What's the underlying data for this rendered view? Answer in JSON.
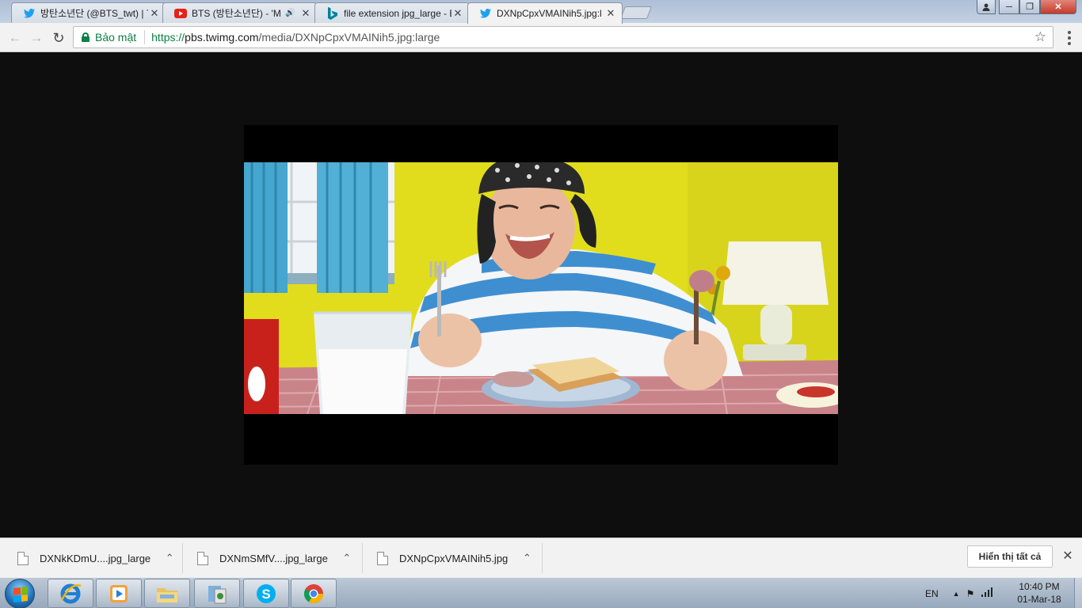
{
  "tabs": [
    {
      "title": "방탄소년단 (@BTS_twt) | T",
      "icon": "twitter-icon",
      "close": "✕"
    },
    {
      "title": "BTS (방탄소년단) - 'M",
      "icon": "youtube-icon",
      "audio": "🔊",
      "close": "✕"
    },
    {
      "title": "file extension jpg_large - B",
      "icon": "bing-icon",
      "close": "✕"
    },
    {
      "title": "DXNpCpxVMAINih5.jpg:l",
      "icon": "twitter-icon",
      "close": "✕",
      "active": true
    }
  ],
  "window_controls": {
    "minimize": "─",
    "maximize": "❐",
    "close": "✕",
    "user": "👤"
  },
  "toolbar": {
    "back": "←",
    "forward": "→",
    "reload": "↻",
    "security_label": "Bảo mật",
    "url_scheme": "https://",
    "url_host": "pbs.twimg.com",
    "url_path": "/media/DXNpCpxVMAINih5.jpg:large",
    "star": "☆"
  },
  "image": {
    "description_icon": "photo-of-person-eating-breakfast"
  },
  "downloads": [
    {
      "name": "DXNkKDmU....jpg_large",
      "chevron": "⌃"
    },
    {
      "name": "DXNmSMfV....jpg_large",
      "chevron": "⌃"
    },
    {
      "name": "DXNpCpxVMAINih5.jpg",
      "chevron": "⌃"
    }
  ],
  "download_bar": {
    "show_all": "Hiển thị tất cả",
    "close": "✕"
  },
  "taskbar": {
    "apps": [
      "internet-explorer-icon",
      "media-player-icon",
      "file-explorer-icon",
      "installer-icon",
      "skype-icon",
      "chrome-icon"
    ],
    "language": "EN",
    "time": "10:40 PM",
    "date": "01-Mar-18"
  }
}
